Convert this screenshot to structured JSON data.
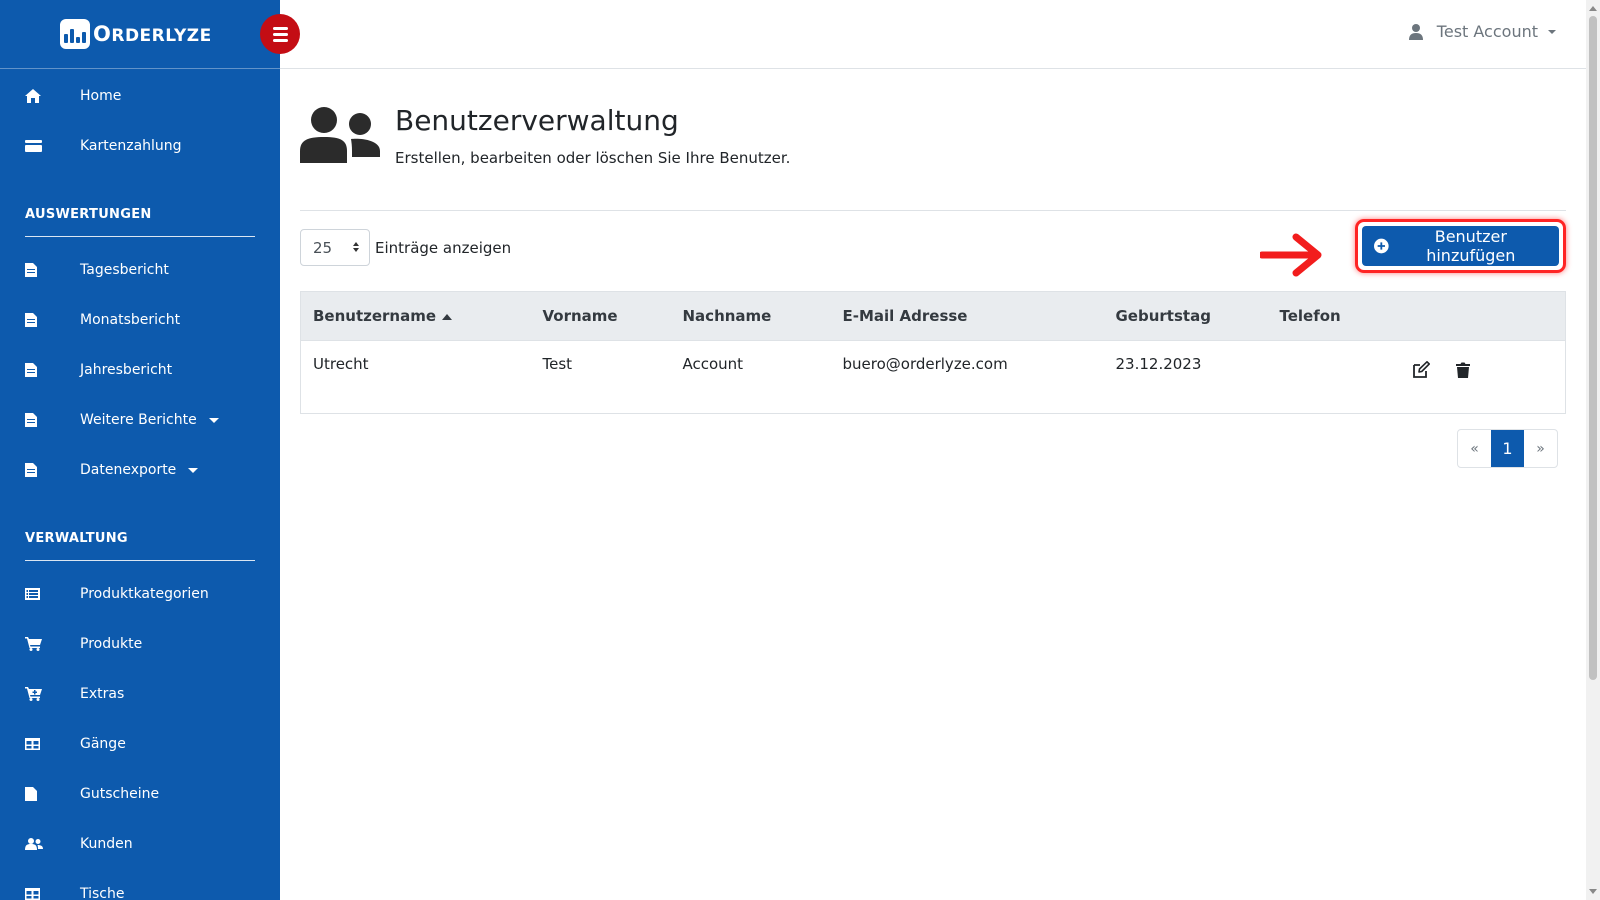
{
  "brand": {
    "logo_text_initial": "O",
    "logo_text_rest": "RDERLYZE"
  },
  "sidebar": {
    "top_items": [
      {
        "label": "Home",
        "icon": "home-icon"
      },
      {
        "label": "Kartenzahlung",
        "icon": "credit-card-icon"
      }
    ],
    "sections": [
      {
        "heading": "AUSWERTUNGEN",
        "items": [
          {
            "label": "Tagesbericht",
            "icon": "file-icon"
          },
          {
            "label": "Monatsbericht",
            "icon": "file-icon"
          },
          {
            "label": "Jahresbericht",
            "icon": "file-icon"
          },
          {
            "label": "Weitere Berichte",
            "icon": "file-icon",
            "dropdown": true
          },
          {
            "label": "Datenexporte",
            "icon": "file-icon",
            "dropdown": true
          }
        ]
      },
      {
        "heading": "VERWALTUNG",
        "items": [
          {
            "label": "Produktkategorien",
            "icon": "list-icon"
          },
          {
            "label": "Produkte",
            "icon": "cart-icon"
          },
          {
            "label": "Extras",
            "icon": "cart-plus-icon"
          },
          {
            "label": "Gänge",
            "icon": "table-icon"
          },
          {
            "label": "Gutscheine",
            "icon": "file-icon"
          },
          {
            "label": "Kunden",
            "icon": "users-icon"
          },
          {
            "label": "Tische",
            "icon": "table-icon"
          }
        ]
      }
    ]
  },
  "topbar": {
    "account_name": "Test Account"
  },
  "page": {
    "title": "Benutzerverwaltung",
    "subtitle": "Erstellen, bearbeiten oder löschen Sie Ihre Benutzer."
  },
  "controls": {
    "page_length": "25",
    "page_length_label": "Einträge anzeigen",
    "add_button_label": "Benutzer hinzufügen"
  },
  "table": {
    "columns": [
      "Benutzername",
      "Vorname",
      "Nachname",
      "E-Mail Adresse",
      "Geburtstag",
      "Telefon"
    ],
    "rows": [
      {
        "username": "Utrecht",
        "firstname": "Test",
        "lastname": "Account",
        "email": "buero@orderlyze.com",
        "birthday": "23.12.2023",
        "phone": ""
      }
    ]
  },
  "pagination": {
    "prev": "«",
    "current": "1",
    "next": "»"
  },
  "colors": {
    "primary": "#0d5aad",
    "toggle": "#c40d14",
    "highlight": "#ff2424"
  }
}
